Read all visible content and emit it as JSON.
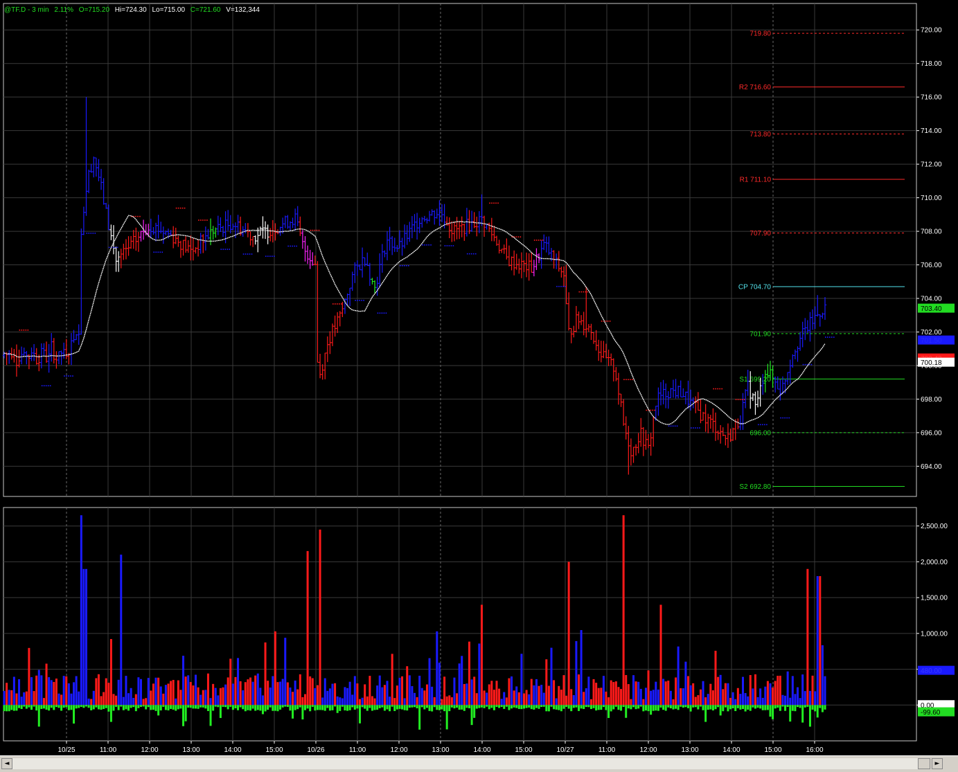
{
  "header": {
    "symbol": "@TF.D - 3 min",
    "change": "2.11%",
    "open": "O=715.20",
    "high": "Hi=724.30",
    "low": "Lo=715.00",
    "close": "C=721.60",
    "volume": "V=132,344"
  },
  "colors": {
    "background": "#000000",
    "panel_border": "#c8c8c8",
    "grid": "#3a3a3a",
    "axis_text": "#ffffff",
    "up_bar": "#1a1aff",
    "down_bar": "#ff1a1a",
    "neutral_bar": "#ffffff",
    "green_bar": "#22ee22",
    "magenta_bar": "#ff22ff",
    "moving_average": "#e6e6e6",
    "resistance": "#ff2a2a",
    "support": "#22dd22",
    "pivot": "#55e5ee",
    "header_green": "#22dd22"
  },
  "chart_data": [
    {
      "type": "ohlc",
      "interval": "3 min",
      "ylim": [
        692.2,
        721.0
      ],
      "y_ticks": [
        "720.00",
        "718.00",
        "716.00",
        "714.00",
        "712.00",
        "710.00",
        "708.00",
        "706.00",
        "704.00",
        "702.00",
        "700.00",
        "698.00",
        "696.00",
        "694.00"
      ],
      "x_ticks": [
        "10/25",
        "11:00",
        "12:00",
        "13:00",
        "14:00",
        "15:00",
        "10/26",
        "11:00",
        "12:00",
        "13:00",
        "14:00",
        "15:00",
        "10/27",
        "11:00",
        "12:00",
        "13:00",
        "14:00",
        "15:00",
        "16:00"
      ],
      "session_start_index": [
        0,
        9,
        17
      ],
      "anchors": [
        {
          "t": 0.0,
          "p": 700.8
        },
        {
          "t": 0.1,
          "p": 701.2
        },
        {
          "t": 0.25,
          "p": 702.3
        },
        {
          "t": 0.3,
          "p": 701.8
        },
        {
          "t": 0.35,
          "p": 708.0
        },
        {
          "t": 0.5,
          "p": 711.0
        },
        {
          "t": 0.65,
          "p": 712.5
        },
        {
          "t": 0.8,
          "p": 711.0
        },
        {
          "t": 1.0,
          "p": 708.5
        },
        {
          "t": 1.2,
          "p": 706.2
        },
        {
          "t": 1.5,
          "p": 707.0
        },
        {
          "t": 2.0,
          "p": 708.4
        },
        {
          "t": 2.5,
          "p": 707.8
        },
        {
          "t": 3.0,
          "p": 706.8
        },
        {
          "t": 3.5,
          "p": 708.0
        },
        {
          "t": 4.0,
          "p": 708.5
        },
        {
          "t": 4.5,
          "p": 707.7
        },
        {
          "t": 5.0,
          "p": 708.2
        },
        {
          "t": 5.5,
          "p": 708.8
        },
        {
          "t": 5.7,
          "p": 707.0
        },
        {
          "t": 6.0,
          "p": 706.0
        },
        {
          "t": 6.05,
          "p": 699.0
        },
        {
          "t": 6.3,
          "p": 701.5
        },
        {
          "t": 6.6,
          "p": 703.0
        },
        {
          "t": 6.9,
          "p": 705.5
        },
        {
          "t": 7.2,
          "p": 706.5
        },
        {
          "t": 7.4,
          "p": 704.5
        },
        {
          "t": 7.7,
          "p": 707.5
        },
        {
          "t": 8.0,
          "p": 707.0
        },
        {
          "t": 8.5,
          "p": 708.8
        },
        {
          "t": 9.0,
          "p": 709.2
        },
        {
          "t": 9.3,
          "p": 708.0
        },
        {
          "t": 9.7,
          "p": 708.4
        },
        {
          "t": 10.0,
          "p": 708.7
        },
        {
          "t": 10.3,
          "p": 707.6
        },
        {
          "t": 10.6,
          "p": 706.3
        },
        {
          "t": 10.9,
          "p": 706.0
        },
        {
          "t": 11.2,
          "p": 705.8
        },
        {
          "t": 11.5,
          "p": 707.2
        },
        {
          "t": 11.8,
          "p": 706.0
        },
        {
          "t": 12.0,
          "p": 705.3
        },
        {
          "t": 12.05,
          "p": 701.8
        },
        {
          "t": 12.3,
          "p": 702.8
        },
        {
          "t": 12.6,
          "p": 702.2
        },
        {
          "t": 12.9,
          "p": 700.5
        },
        {
          "t": 13.2,
          "p": 699.8
        },
        {
          "t": 13.4,
          "p": 696.5
        },
        {
          "t": 13.6,
          "p": 694.8
        },
        {
          "t": 13.8,
          "p": 696.0
        },
        {
          "t": 14.0,
          "p": 695.0
        },
        {
          "t": 14.2,
          "p": 698.0
        },
        {
          "t": 14.5,
          "p": 698.5
        },
        {
          "t": 14.8,
          "p": 698.4
        },
        {
          "t": 15.0,
          "p": 697.8
        },
        {
          "t": 15.3,
          "p": 697.0
        },
        {
          "t": 15.6,
          "p": 696.4
        },
        {
          "t": 15.9,
          "p": 695.6
        },
        {
          "t": 16.2,
          "p": 696.8
        },
        {
          "t": 16.4,
          "p": 698.8
        },
        {
          "t": 16.6,
          "p": 697.5
        },
        {
          "t": 16.8,
          "p": 699.8
        },
        {
          "t": 17.0,
          "p": 699.2
        },
        {
          "t": 17.2,
          "p": 698.5
        },
        {
          "t": 17.5,
          "p": 701.0
        },
        {
          "t": 17.8,
          "p": 702.2
        },
        {
          "t": 18.0,
          "p": 702.8
        },
        {
          "t": 18.2,
          "p": 703.4
        }
      ],
      "last_values": [
        {
          "label": "703.40",
          "bg": "#22dd22",
          "fg": "#000000"
        },
        {
          "label": "701.50",
          "bg": "#1a1aff",
          "fg": "#2a2aff"
        },
        {
          "label": "700.43",
          "bg": "#ff1a1a",
          "fg": "#ff4444"
        },
        {
          "label": "700.18",
          "bg": "#ffffff",
          "fg": "#000000"
        }
      ],
      "last_value_prices": [
        703.4,
        701.5,
        700.43,
        700.18
      ],
      "pivot_levels": [
        {
          "label": "719.80",
          "price": 719.8,
          "color": "#ff2a2a",
          "dashed": true
        },
        {
          "label": "R2 716.60",
          "price": 716.6,
          "color": "#ff2a2a",
          "dashed": false
        },
        {
          "label": "713.80",
          "price": 713.8,
          "color": "#ff2a2a",
          "dashed": true
        },
        {
          "label": "R1 711.10",
          "price": 711.1,
          "color": "#ff2a2a",
          "dashed": false
        },
        {
          "label": "707.90",
          "price": 707.9,
          "color": "#ff2a2a",
          "dashed": true
        },
        {
          "label": "CP 704.70",
          "price": 704.7,
          "color": "#55e5ee",
          "dashed": false
        },
        {
          "label": "701.90",
          "price": 701.9,
          "color": "#22dd22",
          "dashed": true
        },
        {
          "label": "S1 699.20",
          "price": 699.2,
          "color": "#22dd22",
          "dashed": false
        },
        {
          "label": "696.00",
          "price": 696.0,
          "color": "#22dd22",
          "dashed": true
        },
        {
          "label": "S2 692.80",
          "price": 692.8,
          "color": "#22dd22",
          "dashed": false
        }
      ],
      "series": [
        {
          "name": "",
          "kind": "moving-average"
        }
      ]
    },
    {
      "type": "bar",
      "ylim": [
        -500,
        2700
      ],
      "y_ticks": [
        "2,500.00",
        "2,000.00",
        "1,500.00",
        "1,000.00",
        "500.00",
        "0.00"
      ],
      "last_values": [
        {
          "label": "480.00",
          "bg": "#1a1aff",
          "fg": "#3a3aff"
        },
        {
          "label": "0.00",
          "bg": "#ffffff",
          "fg": "#000000"
        },
        {
          "label": "-99.60",
          "bg": "#22dd22",
          "fg": "#000000"
        }
      ],
      "last_value_numbers": [
        480,
        0,
        -99.6
      ],
      "spikes": [
        {
          "t": 0.35,
          "v": 2650
        },
        {
          "t": 0.4,
          "v": 2500
        },
        {
          "t": 0.45,
          "v": 1900
        },
        {
          "t": 1.3,
          "v": 2100
        },
        {
          "t": 5.8,
          "v": 2150
        },
        {
          "t": 6.1,
          "v": 2450
        },
        {
          "t": 10.0,
          "v": 1400
        },
        {
          "t": 12.1,
          "v": 2000
        },
        {
          "t": 13.4,
          "v": 2650
        },
        {
          "t": 14.3,
          "v": 1400
        },
        {
          "t": 17.85,
          "v": 1900
        },
        {
          "t": 18.1,
          "v": 1800
        }
      ]
    }
  ],
  "scrollbar": {
    "left_arrow": "◄",
    "right_arrow": "►"
  }
}
